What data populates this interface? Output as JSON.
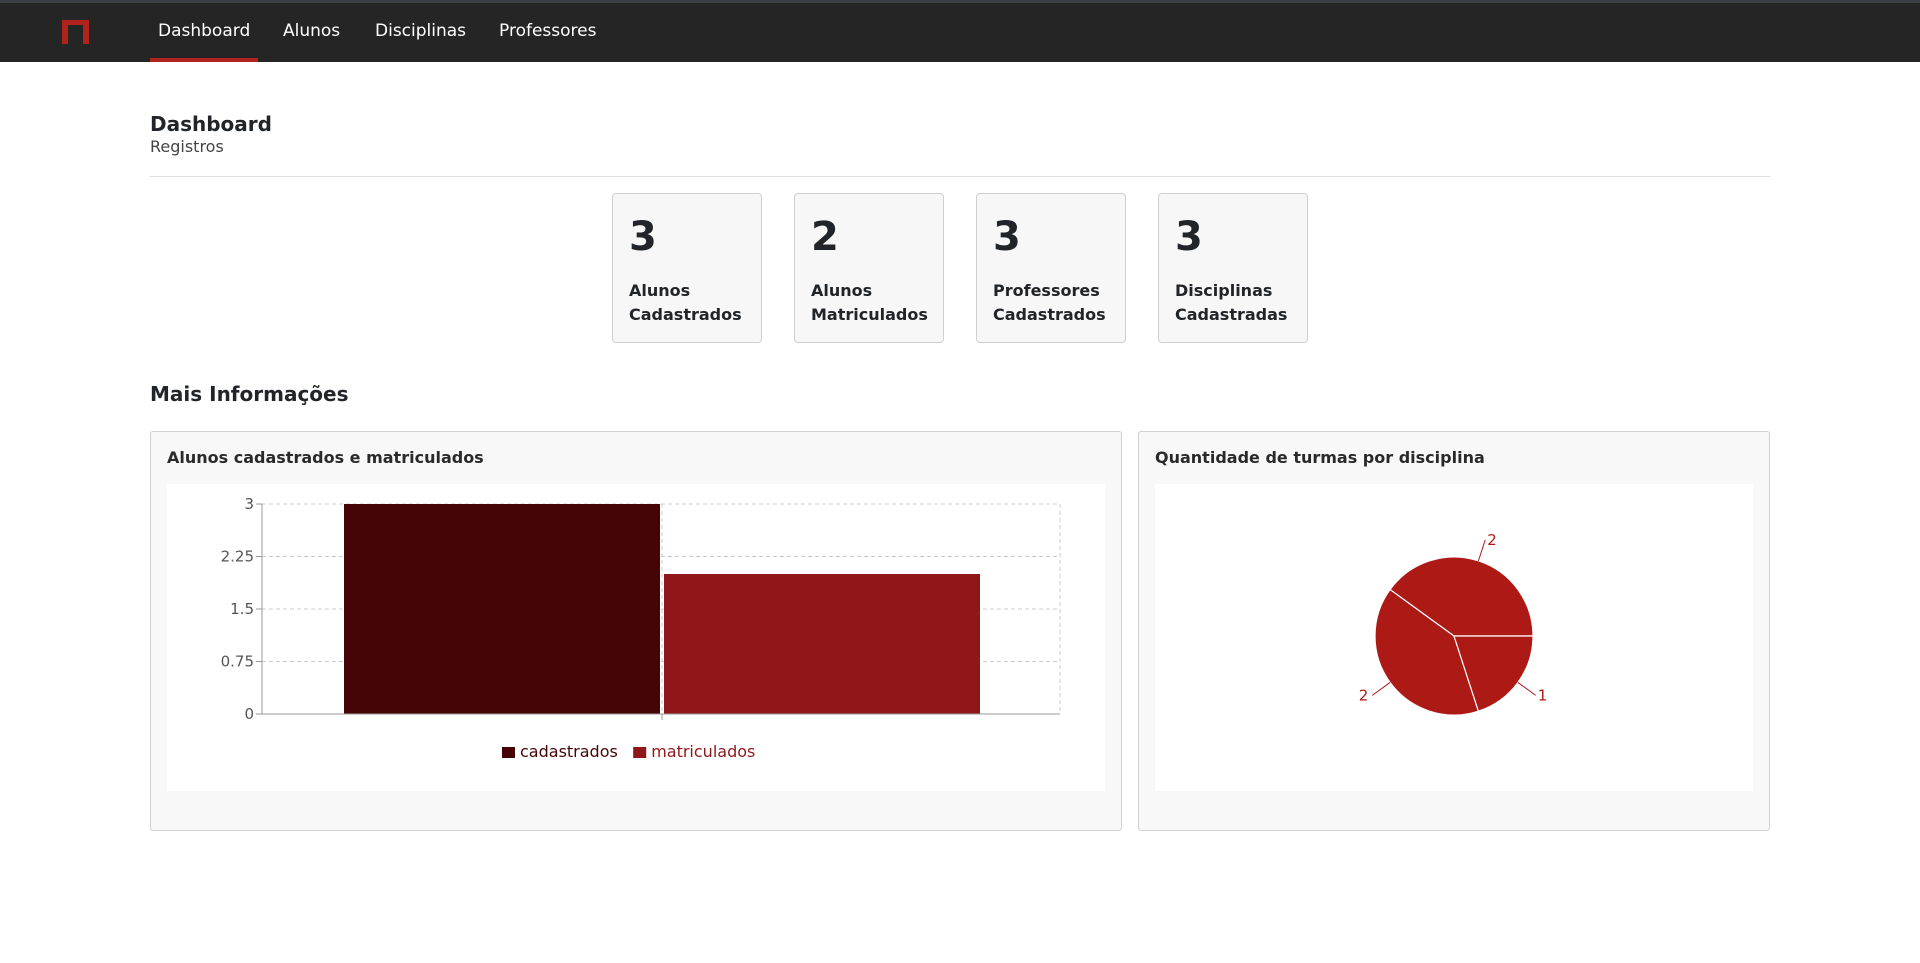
{
  "nav": {
    "items": [
      {
        "label": "Dashboard",
        "active": true
      },
      {
        "label": "Alunos",
        "active": false
      },
      {
        "label": "Disciplinas",
        "active": false
      },
      {
        "label": "Professores",
        "active": false
      }
    ]
  },
  "header": {
    "title": "Dashboard",
    "subtitle": "Registros"
  },
  "stats": [
    {
      "value": "3",
      "label": "Alunos Cadastrados"
    },
    {
      "value": "2",
      "label": "Alunos Matriculados"
    },
    {
      "value": "3",
      "label": "Professores Cadastrados"
    },
    {
      "value": "3",
      "label": "Disciplinas Cadastradas"
    }
  ],
  "section": {
    "title": "Mais Informações"
  },
  "colors": {
    "brand": "#b0231c",
    "cadastrados": "#450507",
    "matriculados": "#8f1619",
    "pie": "#ad1a16"
  },
  "panels": {
    "bar_title": "Alunos cadastrados e matriculados",
    "pie_title": "Quantidade de turmas por disciplina"
  },
  "chart_data": [
    {
      "type": "bar",
      "title": "Alunos cadastrados e matriculados",
      "series": [
        {
          "name": "cadastrados",
          "values": [
            3
          ]
        },
        {
          "name": "matriculados",
          "values": [
            2
          ]
        }
      ],
      "ylim": [
        0,
        3
      ],
      "yticks": [
        "0",
        "0.75",
        "1.5",
        "2.25",
        "3"
      ],
      "grid": true,
      "legend": "bottom"
    },
    {
      "type": "pie",
      "title": "Quantidade de turmas por disciplina",
      "values": [
        2,
        2,
        1
      ],
      "labels": [
        "2",
        "2",
        "1"
      ]
    }
  ]
}
